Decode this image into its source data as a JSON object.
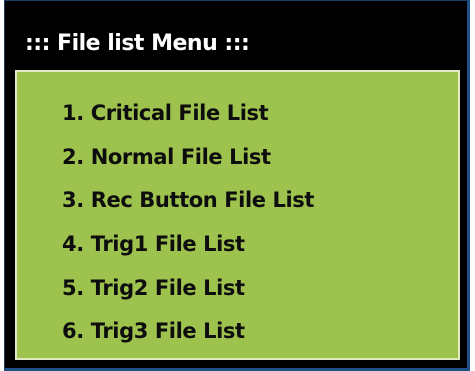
{
  "menu": {
    "title": "::: File list Menu :::",
    "items": [
      {
        "label": "1. Critical File List"
      },
      {
        "label": "2. Normal File List"
      },
      {
        "label": "3. Rec Button File List"
      },
      {
        "label": "4. Trig1 File List"
      },
      {
        "label": "5. Trig2 File List"
      },
      {
        "label": "6. Trig3 File List"
      }
    ]
  },
  "colors": {
    "header_bg": "#000000",
    "menu_bg": "#9ec24e",
    "frame": "#1f4f87",
    "text_dark": "#0d0d0d",
    "text_light": "#ffffff"
  }
}
